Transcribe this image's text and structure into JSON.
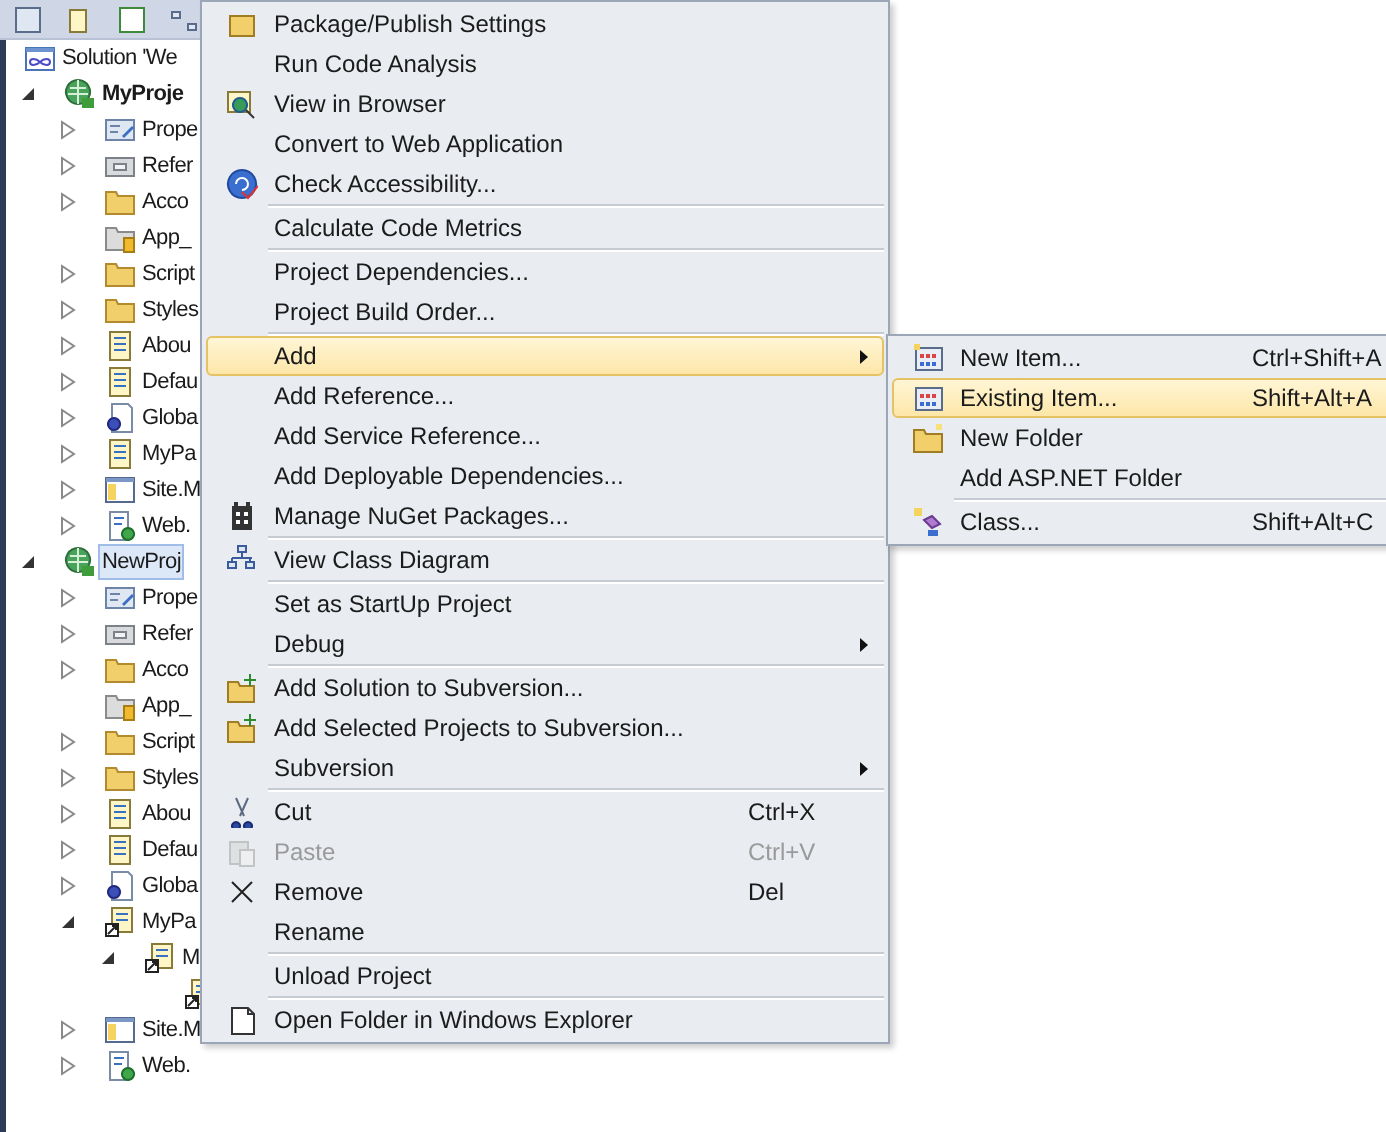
{
  "tree": {
    "items": [
      {
        "label": "Solution 'We",
        "kind": "solution",
        "selected": false,
        "bold": false,
        "children": [
          {
            "label": "MyProje",
            "kind": "project",
            "expanded": true,
            "selected": false,
            "bold": true,
            "children": [
              {
                "label": "Prope",
                "kind": "properties",
                "expanded": false,
                "selected": false,
                "bold": false
              },
              {
                "label": "Refer",
                "kind": "references",
                "expanded": false,
                "selected": false,
                "bold": false
              },
              {
                "label": "Acco",
                "kind": "folder",
                "expanded": false,
                "selected": false,
                "bold": false
              },
              {
                "label": "App_",
                "kind": "appdata",
                "selected": false,
                "bold": false
              },
              {
                "label": "Script",
                "kind": "folder",
                "expanded": false,
                "selected": false,
                "bold": false
              },
              {
                "label": "Styles",
                "kind": "folder",
                "expanded": false,
                "selected": false,
                "bold": false
              },
              {
                "label": "Abou",
                "kind": "page",
                "expanded": false,
                "selected": false,
                "bold": false
              },
              {
                "label": "Defau",
                "kind": "page",
                "expanded": false,
                "selected": false,
                "bold": false
              },
              {
                "label": "Globa",
                "kind": "global",
                "expanded": false,
                "selected": false,
                "bold": false
              },
              {
                "label": "MyPa",
                "kind": "page",
                "expanded": false,
                "selected": false,
                "bold": false
              },
              {
                "label": "Site.M",
                "kind": "master",
                "expanded": false,
                "selected": false,
                "bold": false
              },
              {
                "label": "Web.",
                "kind": "webconfig",
                "expanded": false,
                "selected": false,
                "bold": false
              }
            ]
          },
          {
            "label": "NewProj",
            "kind": "project",
            "expanded": true,
            "selected": true,
            "bold": false,
            "children": [
              {
                "label": "Prope",
                "kind": "properties",
                "expanded": false,
                "selected": false,
                "bold": false
              },
              {
                "label": "Refer",
                "kind": "references",
                "expanded": false,
                "selected": false,
                "bold": false
              },
              {
                "label": "Acco",
                "kind": "folder",
                "expanded": false,
                "selected": false,
                "bold": false
              },
              {
                "label": "App_",
                "kind": "appdata",
                "selected": false,
                "bold": false
              },
              {
                "label": "Script",
                "kind": "folder",
                "expanded": false,
                "selected": false,
                "bold": false
              },
              {
                "label": "Styles",
                "kind": "folder",
                "expanded": false,
                "selected": false,
                "bold": false
              },
              {
                "label": "Abou",
                "kind": "page",
                "expanded": false,
                "selected": false,
                "bold": false
              },
              {
                "label": "Defau",
                "kind": "page",
                "expanded": false,
                "selected": false,
                "bold": false
              },
              {
                "label": "Globa",
                "kind": "global",
                "expanded": false,
                "selected": false,
                "bold": false
              },
              {
                "label": "MyPa",
                "kind": "linked",
                "expanded": true,
                "selected": false,
                "bold": false,
                "children": [
                  {
                    "label": "M",
                    "kind": "linked",
                    "expanded": true,
                    "selected": false,
                    "bold": false,
                    "children": [
                      {
                        "kind": "linked"
                      }
                    ]
                  }
                ]
              },
              {
                "label": "Site.M",
                "kind": "master",
                "expanded": false,
                "selected": false,
                "bold": false
              },
              {
                "label": "Web.",
                "kind": "webconfig",
                "expanded": false,
                "selected": false,
                "bold": false
              }
            ]
          }
        ]
      }
    ]
  },
  "menu": {
    "items": [
      {
        "kind": "publish",
        "label": "Package/Publish Settings",
        "submenu": false,
        "selected": false,
        "disabled": false
      },
      {
        "kind": "plain",
        "label": "Run Code Analysis",
        "submenu": false,
        "selected": false,
        "disabled": false
      },
      {
        "kind": "browser",
        "label": "View in Browser",
        "submenu": false,
        "selected": false,
        "disabled": false
      },
      {
        "kind": "plain",
        "label": "Convert to Web Application",
        "submenu": false,
        "selected": false,
        "disabled": false
      },
      {
        "kind": "accessibility",
        "label": "Check Accessibility...",
        "submenu": false,
        "selected": false,
        "disabled": false
      },
      {
        "kind": "separator"
      },
      {
        "kind": "plain",
        "label": "Calculate Code Metrics",
        "submenu": false,
        "selected": false,
        "disabled": false
      },
      {
        "kind": "separator"
      },
      {
        "kind": "plain",
        "label": "Project Dependencies...",
        "submenu": false,
        "selected": false,
        "disabled": false
      },
      {
        "kind": "plain",
        "label": "Project Build Order...",
        "submenu": false,
        "selected": false,
        "disabled": false
      },
      {
        "kind": "separator"
      },
      {
        "kind": "plain",
        "label": "Add",
        "submenu": true,
        "selected": true,
        "disabled": false
      },
      {
        "kind": "plain",
        "label": "Add Reference...",
        "submenu": false,
        "selected": false,
        "disabled": false
      },
      {
        "kind": "plain",
        "label": "Add Service Reference...",
        "submenu": false,
        "selected": false,
        "disabled": false
      },
      {
        "kind": "plain",
        "label": "Add Deployable Dependencies...",
        "submenu": false,
        "selected": false,
        "disabled": false
      },
      {
        "kind": "nuget",
        "label": "Manage NuGet Packages...",
        "submenu": false,
        "selected": false,
        "disabled": false
      },
      {
        "kind": "separator"
      },
      {
        "kind": "classdiagram",
        "label": "View Class Diagram",
        "submenu": false,
        "selected": false,
        "disabled": false
      },
      {
        "kind": "separator"
      },
      {
        "kind": "plain",
        "label": "Set as StartUp Project",
        "submenu": false,
        "selected": false,
        "disabled": false
      },
      {
        "kind": "plain",
        "label": "Debug",
        "submenu": true,
        "selected": false,
        "disabled": false
      },
      {
        "kind": "separator"
      },
      {
        "kind": "svnadd",
        "label": "Add Solution to Subversion...",
        "submenu": false,
        "selected": false,
        "disabled": false
      },
      {
        "kind": "svnadd",
        "label": "Add Selected Projects to Subversion...",
        "submenu": false,
        "selected": false,
        "disabled": false
      },
      {
        "kind": "plain",
        "label": "Subversion",
        "submenu": true,
        "selected": false,
        "disabled": false
      },
      {
        "kind": "separator"
      },
      {
        "kind": "cut",
        "label": "Cut",
        "shortcut": "Ctrl+X",
        "submenu": false,
        "selected": false,
        "disabled": false
      },
      {
        "kind": "paste",
        "label": "Paste",
        "shortcut": "Ctrl+V",
        "submenu": false,
        "selected": false,
        "disabled": true
      },
      {
        "kind": "remove",
        "label": "Remove",
        "shortcut": "Del",
        "submenu": false,
        "selected": false,
        "disabled": false
      },
      {
        "kind": "plain",
        "label": "Rename",
        "submenu": false,
        "selected": false,
        "disabled": false
      },
      {
        "kind": "separator"
      },
      {
        "kind": "plain",
        "label": "Unload Project",
        "submenu": false,
        "selected": false,
        "disabled": false
      },
      {
        "kind": "separator"
      },
      {
        "kind": "openfolder",
        "label": "Open Folder in Windows Explorer",
        "submenu": false,
        "selected": false,
        "disabled": false
      }
    ]
  },
  "submenu": {
    "items": [
      {
        "kind": "newitem",
        "label": "New Item...",
        "shortcut": "Ctrl+Shift+A",
        "selected": false
      },
      {
        "kind": "existing",
        "label": "Existing Item...",
        "shortcut": "Shift+Alt+A",
        "selected": true
      },
      {
        "kind": "newfolder",
        "label": "New Folder",
        "selected": false
      },
      {
        "kind": "plain",
        "label": "Add ASP.NET Folder",
        "selected": false
      },
      {
        "kind": "separator"
      },
      {
        "kind": "class",
        "label": "Class...",
        "shortcut": "Shift+Alt+C",
        "selected": false
      }
    ]
  }
}
